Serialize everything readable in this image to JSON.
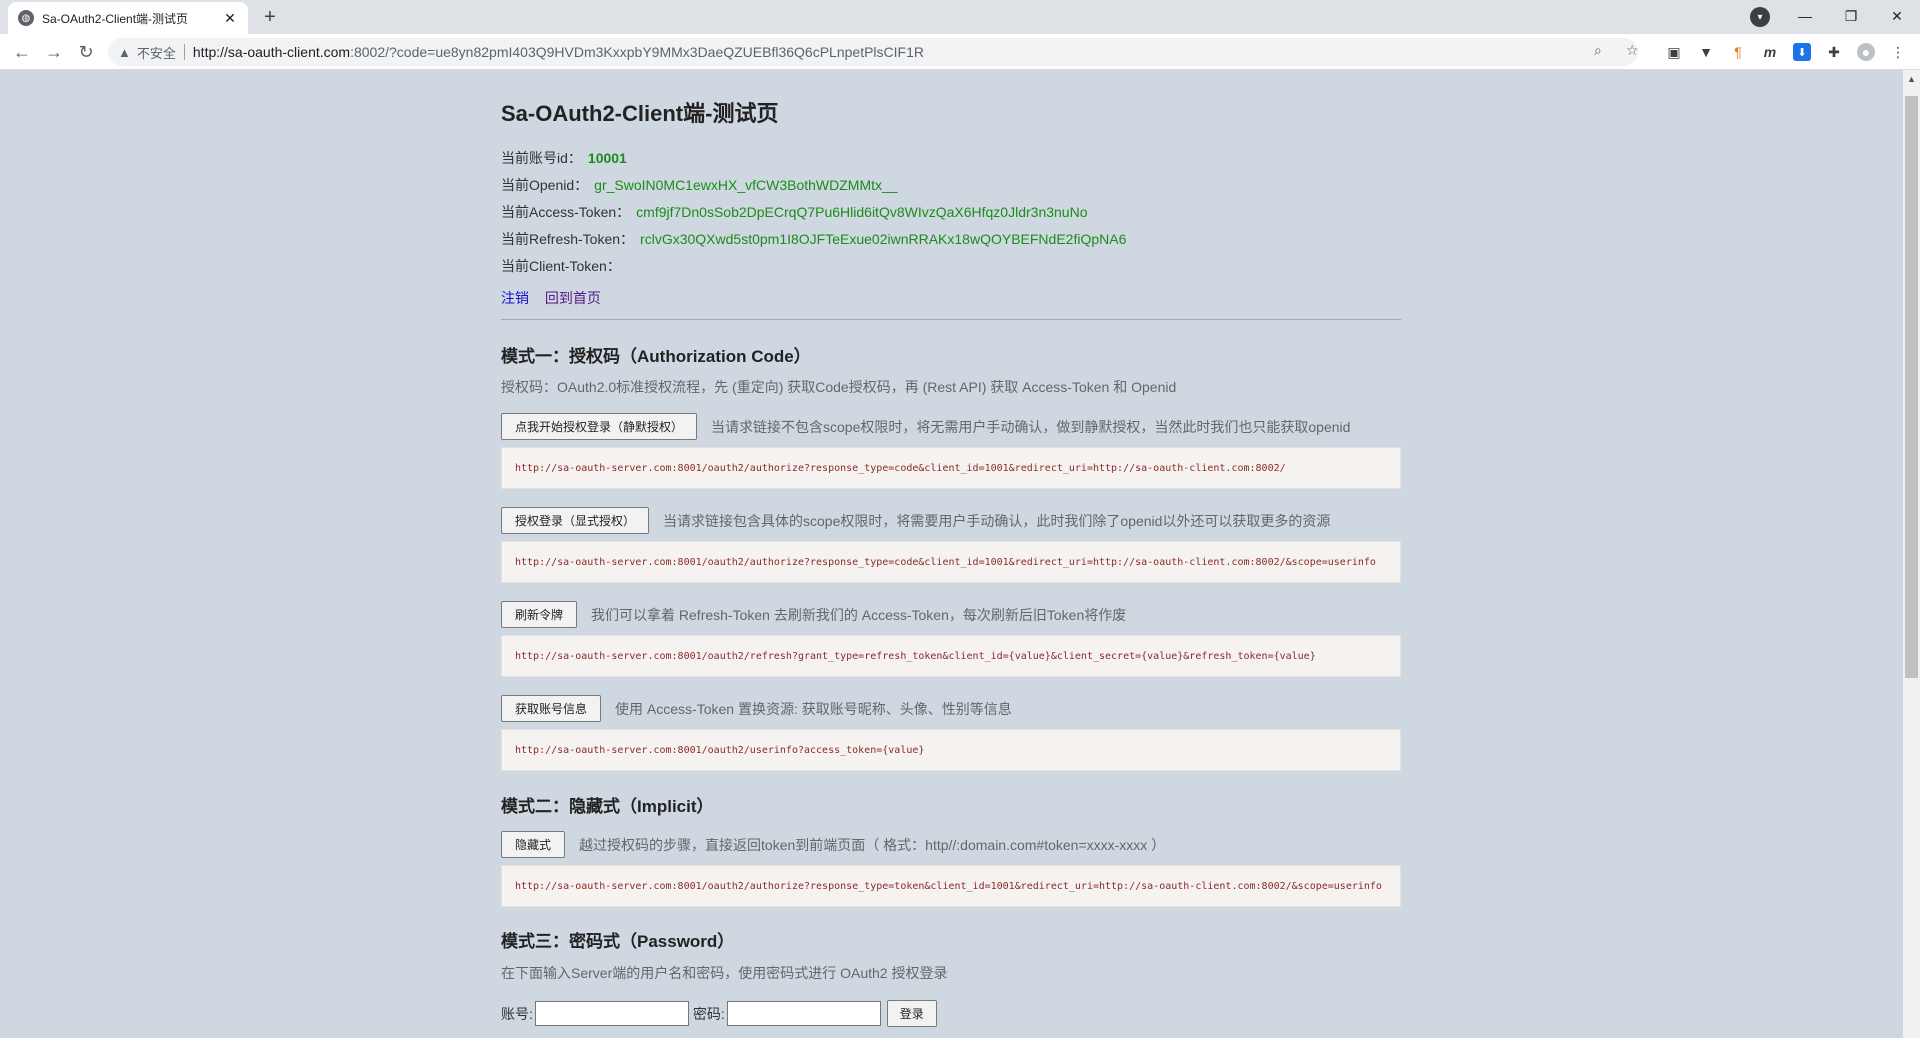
{
  "browser": {
    "tab_title": "Sa-OAuth2-Client端-测试页",
    "tab_close": "✕",
    "new_tab": "+",
    "insecure_label": "不安全",
    "url_host": "http://sa-oauth-client.com",
    "url_rest": ":8002/?code=ue8yn82pmI403Q9HVDm3KxxpbY9MMx3DaeQZUEBfl36Q6cPLnpetPlsCIF1R",
    "window_minimize": "—",
    "window_restore": "❐",
    "window_close": "✕"
  },
  "page": {
    "title": "Sa-OAuth2-Client端-测试页",
    "info": [
      {
        "label": "当前账号id：",
        "value": "10001"
      },
      {
        "label": "当前Openid：",
        "value": "gr_SwoIN0MC1ewxHX_vfCW3BothWDZMMtx__"
      },
      {
        "label": "当前Access-Token：",
        "value": "cmf9jf7Dn0sSob2DpECrqQ7Pu6Hlid6itQv8WIvzQaX6Hfqz0Jldr3n3nuNo"
      },
      {
        "label": "当前Refresh-Token：",
        "value": "rclvGx30QXwd5st0pm1I8OJFTeExue02iwnRRAKx18wQOYBEFNdE2fiQpNA6"
      },
      {
        "label": "当前Client-Token：",
        "value": ""
      }
    ],
    "links": {
      "logout": "注销",
      "home": "回到首页"
    },
    "mode1": {
      "title": "模式一：授权码（Authorization Code）",
      "desc": "授权码：OAuth2.0标准授权流程，先 (重定向) 获取Code授权码，再 (Rest API) 获取 Access-Token 和 Openid",
      "items": [
        {
          "button": "点我开始授权登录（静默授权）",
          "desc": "当请求链接不包含scope权限时，将无需用户手动确认，做到静默授权，当然此时我们也只能获取openid",
          "code": "http://sa-oauth-server.com:8001/oauth2/authorize?response_type=code&client_id=1001&redirect_uri=http://sa-oauth-client.com:8002/"
        },
        {
          "button": "授权登录（显式授权）",
          "desc": "当请求链接包含具体的scope权限时，将需要用户手动确认，此时我们除了openid以外还可以获取更多的资源",
          "code": "http://sa-oauth-server.com:8001/oauth2/authorize?response_type=code&client_id=1001&redirect_uri=http://sa-oauth-client.com:8002/&scope=userinfo"
        },
        {
          "button": "刷新令牌",
          "desc": "我们可以拿着 Refresh-Token 去刷新我们的 Access-Token，每次刷新后旧Token将作废",
          "code": "http://sa-oauth-server.com:8001/oauth2/refresh?grant_type=refresh_token&client_id={value}&client_secret={value}&refresh_token={value}"
        },
        {
          "button": "获取账号信息",
          "desc": "使用 Access-Token 置换资源: 获取账号昵称、头像、性别等信息",
          "code": "http://sa-oauth-server.com:8001/oauth2/userinfo?access_token={value}"
        }
      ]
    },
    "mode2": {
      "title": "模式二：隐藏式（Implicit）",
      "button": "隐藏式",
      "desc": "越过授权码的步骤，直接返回token到前端页面（ 格式：http//:domain.com#token=xxxx-xxxx ）",
      "code": "http://sa-oauth-server.com:8001/oauth2/authorize?response_type=token&client_id=1001&redirect_uri=http://sa-oauth-client.com:8002/&scope=userinfo"
    },
    "mode3": {
      "title": "模式三：密码式（Password）",
      "desc": "在下面输入Server端的用户名和密码，使用密码式进行 OAuth2 授权登录",
      "username_label": "账号:",
      "password_label": "密码:",
      "login_button": "登录"
    }
  },
  "colors": {
    "page_bg": "#cfd8e0",
    "value_green": "#1b8c1b",
    "link_blue": "#1a0dcc",
    "code_bg": "#f5f2f0"
  }
}
